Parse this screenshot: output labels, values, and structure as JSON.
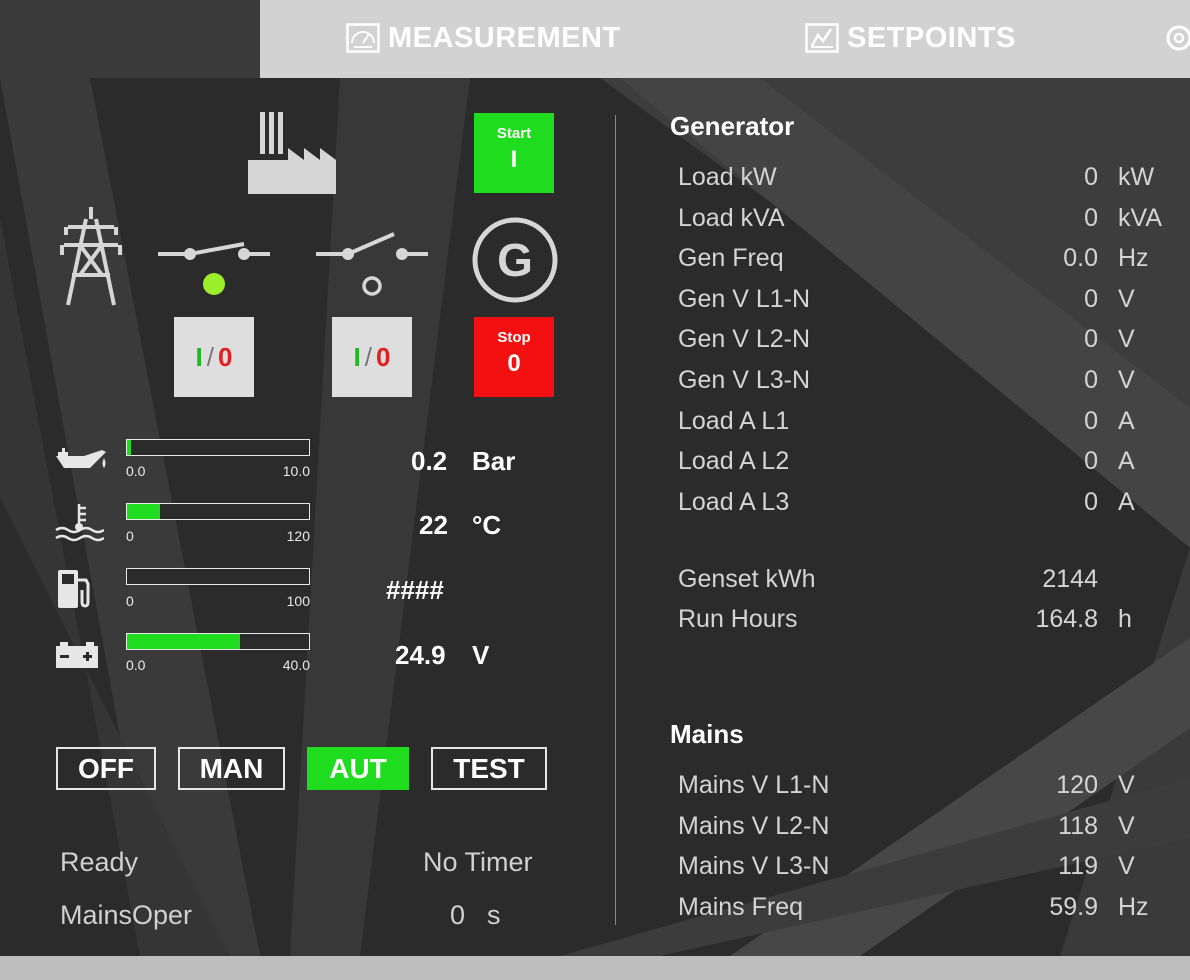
{
  "tabs": [
    {
      "label": "MEASUREMENT",
      "icon": "gauge-icon"
    },
    {
      "label": "SETPOINTS",
      "icon": "setpoints-icon"
    }
  ],
  "controls": {
    "start_label": "Start",
    "start_symbol": "I",
    "stop_label": "Stop",
    "stop_symbol": "0",
    "mains_breaker": {
      "i": "I",
      "sep": "/",
      "o": "0",
      "indicator": "closed"
    },
    "gen_breaker": {
      "i": "I",
      "sep": "/",
      "o": "0",
      "indicator": "open"
    },
    "generator_symbol": "G"
  },
  "meters": [
    {
      "name": "oil-pressure",
      "icon": "oil-can-icon",
      "min": "0.0",
      "max": "10.0",
      "fraction": 0.02,
      "value": "0.2",
      "unit": "Bar"
    },
    {
      "name": "coolant-temp",
      "icon": "coolant-temp-icon",
      "min": "0",
      "max": "120",
      "fraction": 0.18,
      "value": "22",
      "unit": "°C"
    },
    {
      "name": "fuel-level",
      "icon": "fuel-pump-icon",
      "min": "0",
      "max": "100",
      "fraction": 0.0,
      "value": "####",
      "unit": ""
    },
    {
      "name": "battery-voltage",
      "icon": "battery-icon",
      "min": "0.0",
      "max": "40.0",
      "fraction": 0.62,
      "value": "24.9",
      "unit": "V"
    }
  ],
  "modes": [
    {
      "label": "OFF",
      "active": false
    },
    {
      "label": "MAN",
      "active": false
    },
    {
      "label": "AUT",
      "active": true
    },
    {
      "label": "TEST",
      "active": false
    }
  ],
  "status": {
    "engine_state": "Ready",
    "timer_text": "No Timer",
    "breaker_state": "MainsOper",
    "timer_value": "0",
    "timer_unit": "s"
  },
  "generator": {
    "title": "Generator",
    "rows": [
      {
        "label": "Load kW",
        "value": "0",
        "unit": "kW"
      },
      {
        "label": "Load kVA",
        "value": "0",
        "unit": "kVA"
      },
      {
        "label": "Gen Freq",
        "value": "0.0",
        "unit": "Hz"
      },
      {
        "label": "Gen V L1-N",
        "value": "0",
        "unit": "V"
      },
      {
        "label": "Gen V L2-N",
        "value": "0",
        "unit": "V"
      },
      {
        "label": "Gen V L3-N",
        "value": "0",
        "unit": "V"
      },
      {
        "label": "Load A L1",
        "value": "0",
        "unit": "A"
      },
      {
        "label": "Load A L2",
        "value": "0",
        "unit": "A"
      },
      {
        "label": "Load A L3",
        "value": "0",
        "unit": "A"
      }
    ],
    "totals": [
      {
        "label": "Genset kWh",
        "value": "2144",
        "unit": ""
      },
      {
        "label": "Run Hours",
        "value": "164.8",
        "unit": "h"
      }
    ]
  },
  "mains": {
    "title": "Mains",
    "rows": [
      {
        "label": "Mains V L1-N",
        "value": "120",
        "unit": "V"
      },
      {
        "label": "Mains V L2-N",
        "value": "118",
        "unit": "V"
      },
      {
        "label": "Mains V L3-N",
        "value": "119",
        "unit": "V"
      },
      {
        "label": "Mains Freq",
        "value": "59.9",
        "unit": "Hz"
      }
    ]
  },
  "colors": {
    "background": "#2b2b2b",
    "accent_green": "#1fdc1f",
    "stop_red": "#f21010",
    "tabbar": "#d2d2d2"
  }
}
